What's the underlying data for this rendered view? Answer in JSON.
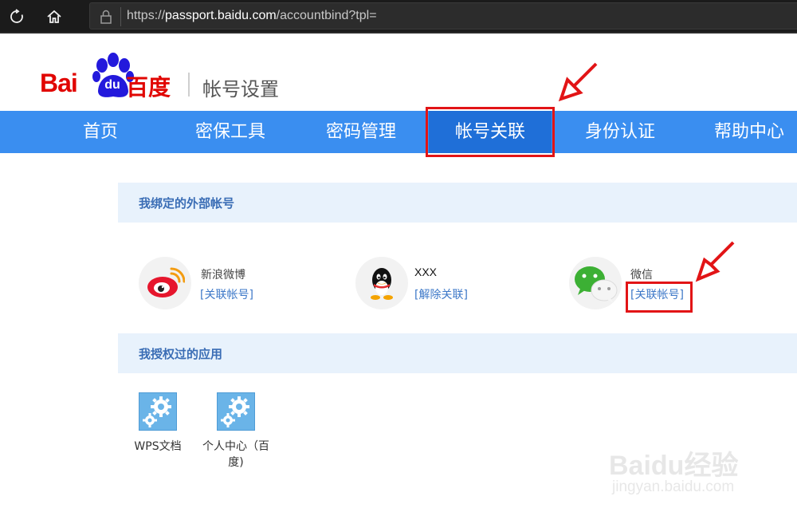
{
  "browser": {
    "url_prefix": "https://",
    "url_host": "passport.baidu.com",
    "url_path": "/accountbind?tpl="
  },
  "header": {
    "logo_left": "Bai",
    "logo_mid": "du",
    "logo_cn": "百度",
    "title": "帐号设置"
  },
  "nav": {
    "tabs": [
      {
        "label": "首页"
      },
      {
        "label": "密保工具"
      },
      {
        "label": "密码管理"
      },
      {
        "label": "帐号关联"
      },
      {
        "label": "身份认证"
      },
      {
        "label": "帮助中心"
      }
    ],
    "active_index": 3
  },
  "external_accounts": {
    "title": "我绑定的外部帐号",
    "items": [
      {
        "name": "新浪微博",
        "action": "[关联帐号]",
        "icon": "weibo-icon"
      },
      {
        "name": "XXX",
        "action": "[解除关联]",
        "icon": "qq-icon"
      },
      {
        "name": "微信",
        "action": "[关联帐号]",
        "icon": "wechat-icon"
      }
    ]
  },
  "authorized_apps": {
    "title": "我授权过的应用",
    "items": [
      {
        "name": "WPS文档",
        "icon": "gear-icon"
      },
      {
        "name": "个人中心（百度)",
        "icon": "gear-icon"
      }
    ]
  },
  "watermark": {
    "line1": "Baidu经验",
    "line2": "jingyan.baidu.com"
  },
  "colors": {
    "nav_bg": "#3a8ef0",
    "nav_active": "#1f6fd8",
    "brand_red": "#e10602",
    "brand_blue": "#2319dc",
    "annotation_red": "#e21416",
    "link_blue": "#3d78c8",
    "section_bg": "#e8f2fc"
  }
}
